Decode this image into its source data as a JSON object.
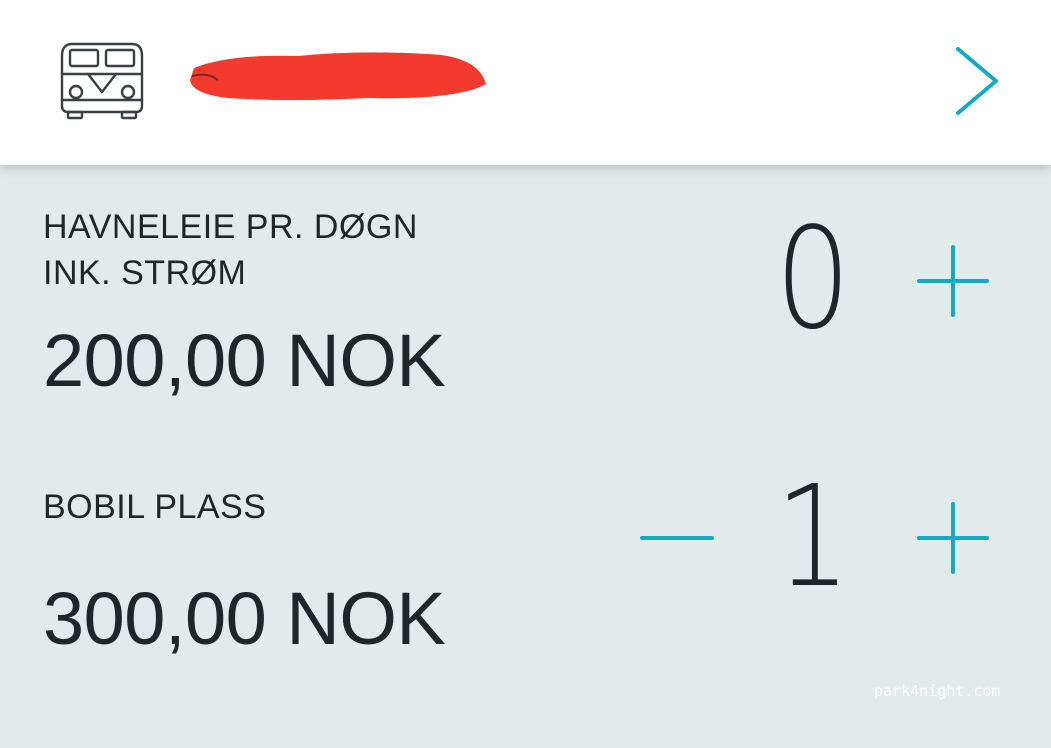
{
  "header": {
    "icon": "van-icon",
    "title_redacted": true,
    "next_icon": "chevron-right-icon"
  },
  "items": [
    {
      "title_line1": "HAVNELEIE PR. DØGN",
      "title_line2": "INK. STRØM",
      "price": "200,00 NOK",
      "quantity": "0",
      "decrement_visible": false
    },
    {
      "title_line1": "BOBIL PLASS",
      "title_line2": "",
      "price": "300,00 NOK",
      "quantity": "1",
      "decrement_visible": true
    }
  ],
  "watermark": "park4night.com",
  "colors": {
    "accent": "#15aabf",
    "background": "#e3eaeb",
    "header_bg": "#ffffff",
    "text": "#1f2528",
    "redaction": "#f23a2e"
  }
}
